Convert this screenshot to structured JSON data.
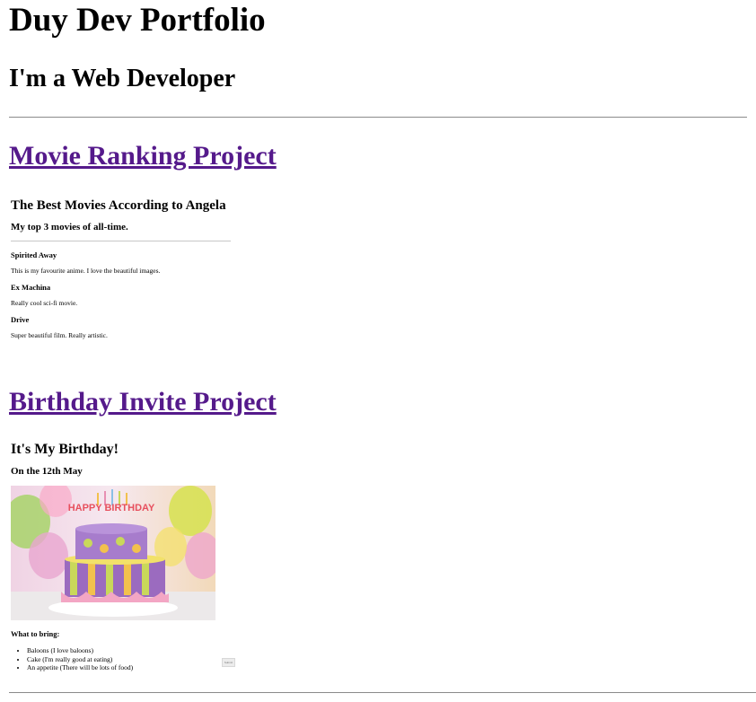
{
  "page": {
    "title": "Duy Dev Portfolio",
    "subtitle": "I'm a Web Developer"
  },
  "projects": {
    "movie": {
      "link_label": "Movie Ranking Project",
      "heading": "The Best Movies According to Angela",
      "subheading": "My top 3 movies of all-time.",
      "movies": [
        {
          "title": "Spirited Away",
          "description": "This is my favourite anime. I love the beautiful images."
        },
        {
          "title": "Ex Machina",
          "description": "Really cool sci-fi movie."
        },
        {
          "title": "Drive",
          "description": "Super beautiful film. Really artistic."
        }
      ]
    },
    "birthday": {
      "link_label": "Birthday Invite Project",
      "heading": "It's My Birthday!",
      "date": "On the 12th May",
      "image_caption": "HAPPY BIRTHDAY",
      "bring_heading": "What to bring:",
      "items": [
        "Baloons (I love baloons)",
        "Cake (I'm really good at eating)",
        "An appetite (There will be lots of food)"
      ],
      "button_label": "Submit"
    }
  },
  "colors": {
    "link": "#551a8b",
    "rule": "#8a8a8a"
  }
}
